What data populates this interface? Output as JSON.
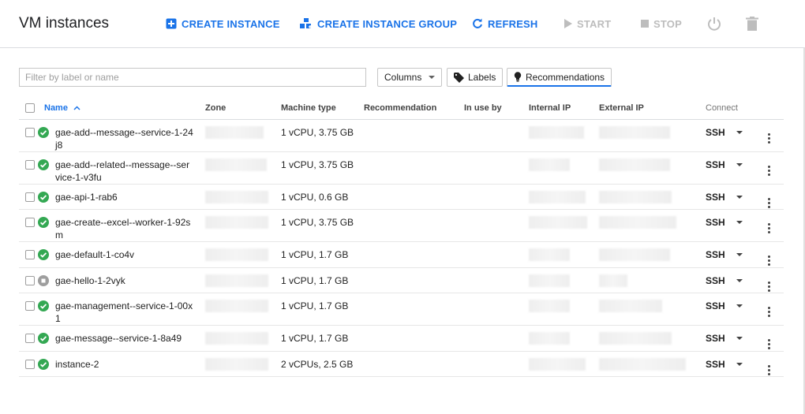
{
  "header": {
    "title": "VM instances",
    "create_instance": "CREATE INSTANCE",
    "create_instance_group": "CREATE INSTANCE GROUP",
    "refresh": "REFRESH",
    "start": "START",
    "stop": "STOP"
  },
  "filter": {
    "placeholder": "Filter by label or name",
    "columns_label": "Columns",
    "labels_label": "Labels",
    "recommendations_label": "Recommendations"
  },
  "table": {
    "columns": {
      "name": "Name",
      "zone": "Zone",
      "machine_type": "Machine type",
      "recommendation": "Recommendation",
      "in_use_by": "In use by",
      "internal_ip": "Internal IP",
      "external_ip": "External IP",
      "connect": "Connect"
    },
    "rows": [
      {
        "name": "gae-add--message--service-1-24j8",
        "status": "running",
        "machine_type": "1 vCPU, 3.75 GB",
        "connect": "SSH"
      },
      {
        "name": "gae-add--related--message--service-1-v3fu",
        "status": "running",
        "machine_type": "1 vCPU, 3.75 GB",
        "connect": "SSH"
      },
      {
        "name": "gae-api-1-rab6",
        "status": "running",
        "machine_type": "1 vCPU, 0.6 GB",
        "connect": "SSH"
      },
      {
        "name": "gae-create--excel--worker-1-92sm",
        "status": "running",
        "machine_type": "1 vCPU, 3.75 GB",
        "connect": "SSH"
      },
      {
        "name": "gae-default-1-co4v",
        "status": "running",
        "machine_type": "1 vCPU, 1.7 GB",
        "connect": "SSH"
      },
      {
        "name": "gae-hello-1-2vyk",
        "status": "stopped",
        "machine_type": "1 vCPU, 1.7 GB",
        "connect": "SSH"
      },
      {
        "name": "gae-management--service-1-00x1",
        "status": "running",
        "machine_type": "1 vCPU, 1.7 GB",
        "connect": "SSH"
      },
      {
        "name": "gae-message--service-1-8a49",
        "status": "running",
        "machine_type": "1 vCPU, 1.7 GB",
        "connect": "SSH"
      },
      {
        "name": "instance-2",
        "status": "running",
        "machine_type": "2 vCPUs, 2.5 GB",
        "connect": "SSH"
      }
    ]
  },
  "colors": {
    "accent": "#1a73e8",
    "running": "#34a853",
    "stopped": "#9e9e9e",
    "disabled": "#bdbdbd"
  },
  "icons": {
    "create_instance": "add-box-icon",
    "create_instance_group": "instance-group-icon",
    "refresh": "refresh-icon",
    "start": "play-icon",
    "stop": "stop-square-icon",
    "reset": "power-icon",
    "delete": "trash-icon",
    "labels": "tag-icon",
    "recommendations": "lightbulb-icon",
    "row_menu": "more-vert-icon",
    "status_running": "check-circle-icon",
    "status_stopped": "stopped-circle-icon"
  }
}
